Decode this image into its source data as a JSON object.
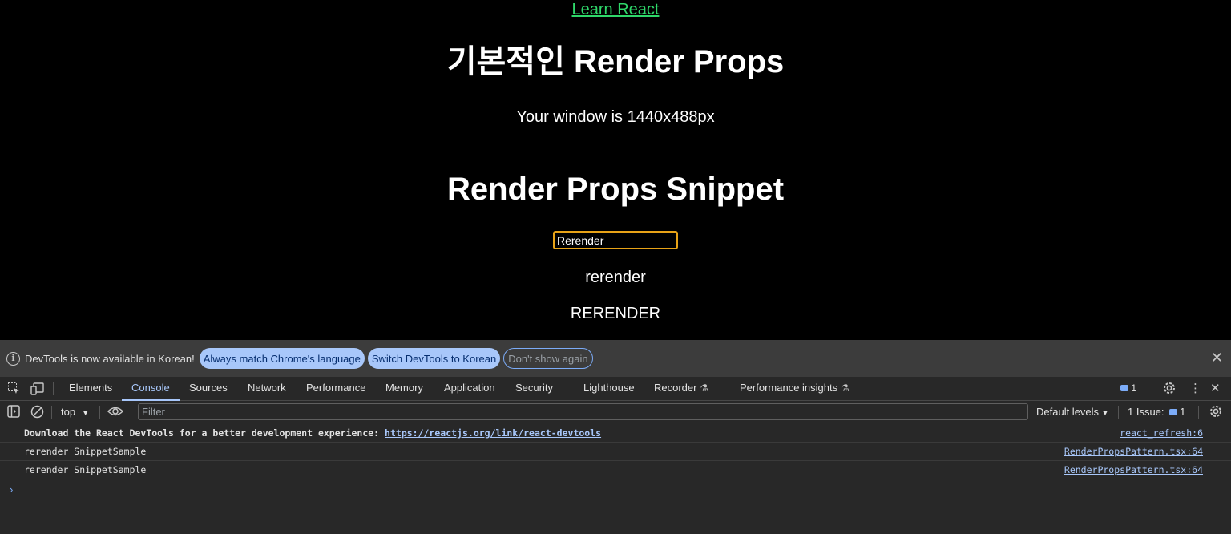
{
  "page": {
    "link": "Learn React",
    "heading_basic": "기본적인 Render Props",
    "window_text": "Your window is 1440x488px",
    "heading_snippet": "Render Props Snippet",
    "input_value": "Rerender",
    "lower_text": "rerender",
    "upper_text": "RERENDER"
  },
  "devtools": {
    "infobar": {
      "message": "DevTools is now available in Korean!",
      "btn_match": "Always match Chrome's language",
      "btn_switch": "Switch DevTools to Korean",
      "btn_dismiss": "Don't show again",
      "close": "✕"
    },
    "tabs": [
      "Elements",
      "Console",
      "Sources",
      "Network",
      "Performance",
      "Memory",
      "Application",
      "Security",
      "Lighthouse",
      "Recorder",
      "Performance insights"
    ],
    "active_tab": "Console",
    "message_count": "1",
    "toolbar": {
      "context": "top",
      "filter_placeholder": "Filter",
      "levels": "Default levels",
      "issues_label": "1 Issue:",
      "issues_count": "1"
    },
    "logs": [
      {
        "prefix": "Download the React DevTools for a better development experience: ",
        "link": "https://reactjs.org/link/react-devtools",
        "source": "react_refresh:6"
      },
      {
        "text": "rerender SnippetSample",
        "source": "RenderPropsPattern.tsx:64"
      },
      {
        "text": "rerender SnippetSample",
        "source": "RenderPropsPattern.tsx:64"
      }
    ],
    "prompt": "›"
  },
  "colors": {
    "link": "#2fd86a",
    "input_focus": "#e8a317",
    "devtools_accent": "#a8c7fa"
  }
}
